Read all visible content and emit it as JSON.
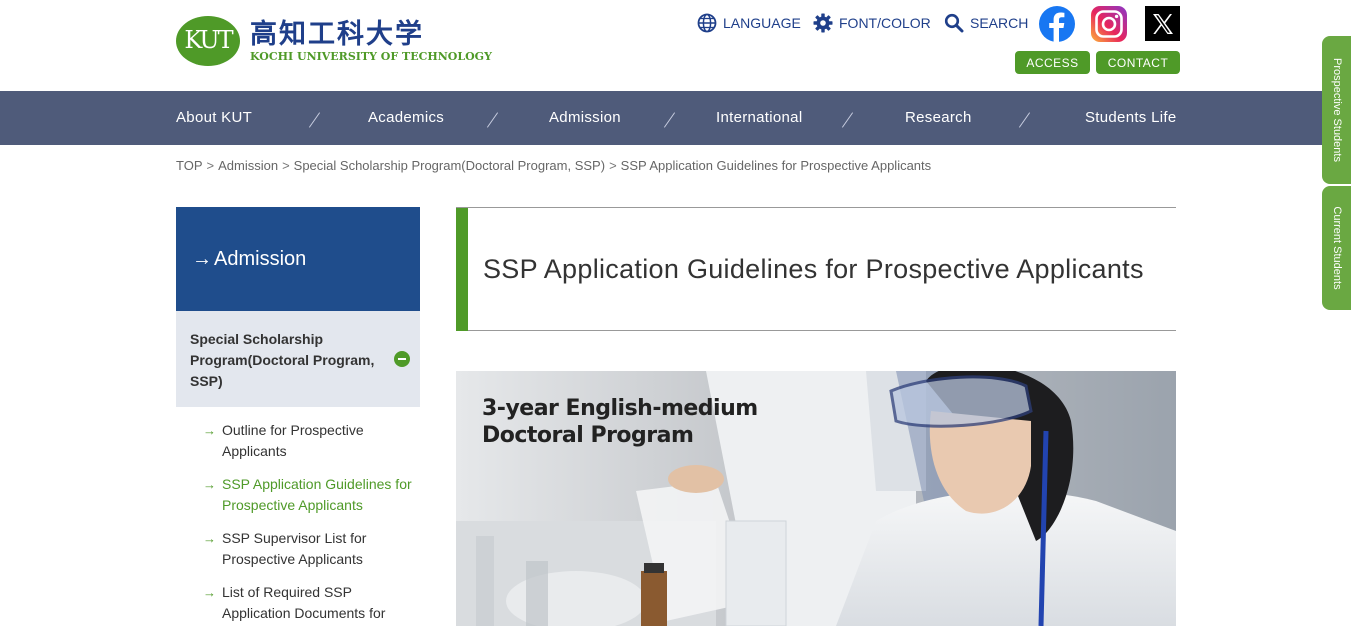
{
  "header": {
    "logo_mark": "KUT",
    "logo_jp": "高知工科大学",
    "logo_en": "KOCHI UNIVERSITY OF TECHNOLOGY",
    "utility": {
      "language": "LANGUAGE",
      "font_color": "FONT/COLOR",
      "search": "SEARCH"
    },
    "buttons": {
      "access": "ACCESS",
      "contact": "CONTACT"
    },
    "sns": [
      "facebook-icon",
      "instagram-icon",
      "x-icon"
    ]
  },
  "nav": {
    "items": [
      "About KUT",
      "Academics",
      "Admission",
      "International",
      "Research",
      "Students Life"
    ]
  },
  "side_tabs": {
    "prospective": "Prospective Students",
    "current": "Current Students"
  },
  "breadcrumb": {
    "items": [
      "TOP",
      "Admission",
      "Special Scholarship Program(Doctoral Program, SSP)",
      "SSP Application Guidelines for Prospective Applicants"
    ],
    "separator": ">"
  },
  "sidebar": {
    "heading": "Admission",
    "arrow": "→",
    "section": "Special Scholarship Program(Doctoral Program, SSP)",
    "link_arrow": "→",
    "links": [
      "Outline for Prospective Applicants",
      "SSP Application Guidelines for Prospective Applicants",
      "SSP Supervisor List for Prospective Applicants",
      "List of Required SSP Application Documents for Prospective"
    ]
  },
  "main": {
    "title": "SSP Application Guidelines for Prospective Applicants",
    "hero": {
      "caption_line1": "3-year English-medium",
      "caption_line2": "Doctoral Program"
    }
  },
  "colors": {
    "green": "#4f9a28",
    "navy": "#1f4d8c",
    "nav_bg": "#4f5b7a",
    "sidebar_sub_bg": "#e3e7ee"
  }
}
